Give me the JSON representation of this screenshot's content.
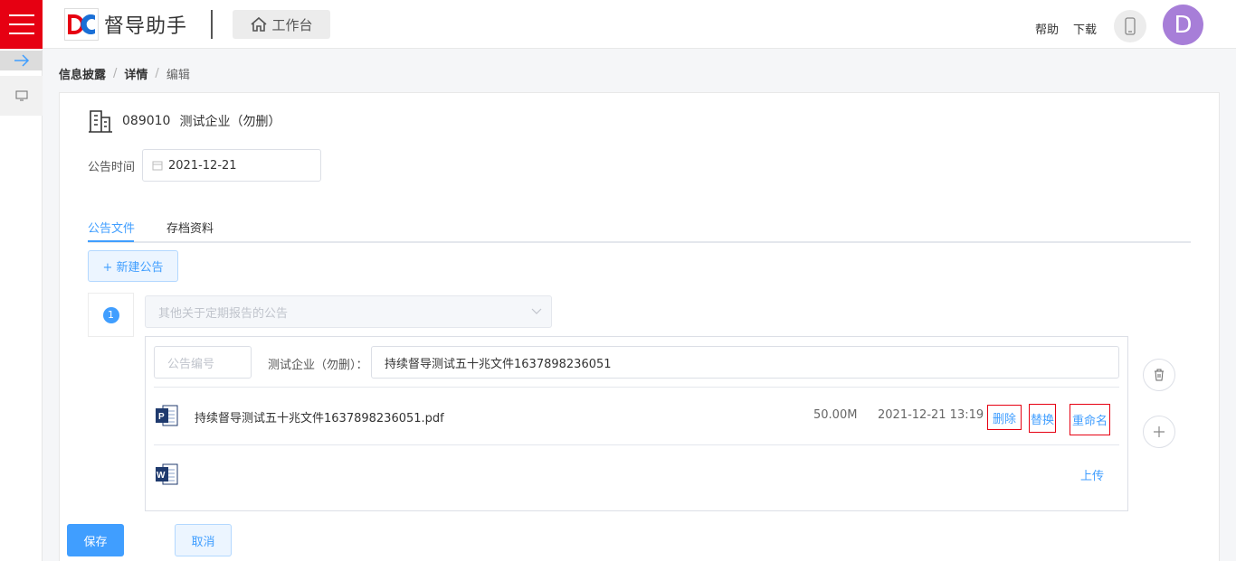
{
  "header": {
    "logo_text": "督导助手",
    "workbench_label": "工作台",
    "help_label": "帮助",
    "download_label": "下载",
    "avatar_letter": "D"
  },
  "breadcrumb": [
    "信息披露",
    "详情",
    "编辑"
  ],
  "company": {
    "code": "089010",
    "name": "测试企业（勿删）"
  },
  "announce_time": {
    "label": "公告时间",
    "value": "2021-12-21"
  },
  "tabs": [
    {
      "label": "公告文件",
      "active": true
    },
    {
      "label": "存档资料",
      "active": false
    }
  ],
  "new_button_label": "+ 新建公告",
  "announcement": {
    "index": "1",
    "type_placeholder": "其他关于定期报告的公告",
    "code_placeholder": "公告编号",
    "title_prefix": "测试企业（勿删）：",
    "title_value": "持续督导测试五十兆文件1637898236051",
    "file": {
      "name": "持续督导测试五十兆文件1637898236051.pdf",
      "size": "50.00M",
      "time": "2021-12-21 13:19",
      "actions": [
        "删除",
        "替换",
        "重命名"
      ]
    },
    "upload_label": "上传"
  },
  "footer": {
    "save_label": "保存",
    "cancel_label": "取消"
  },
  "colors": {
    "brand_red": "#e60012",
    "primary_blue": "#409eff",
    "avatar_purple": "#a77ed8"
  },
  "icons": [
    "menu-icon",
    "home-icon",
    "phone-icon",
    "arrow-right-icon",
    "monitor-icon",
    "building-icon",
    "calendar-icon",
    "chevron-down-icon",
    "pdf-file-icon",
    "word-file-icon",
    "trash-icon",
    "plus-icon"
  ]
}
